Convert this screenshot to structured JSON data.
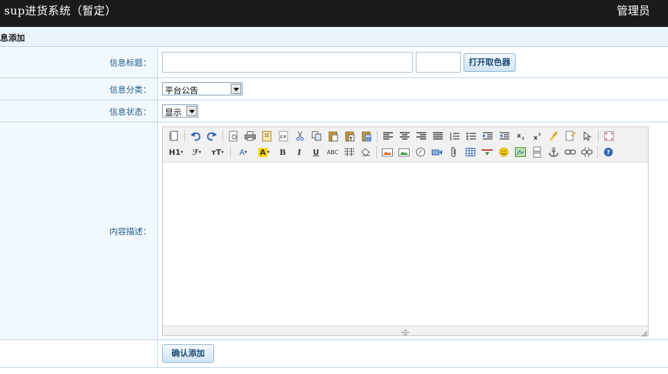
{
  "header": {
    "app_title": "sup进货系统（暂定）",
    "user": "管理员"
  },
  "section": {
    "title": "息添加"
  },
  "form": {
    "title_label": "信息标题：",
    "title_value": "",
    "color_value": "",
    "color_button": "打开取色器",
    "category_label": "信息分类：",
    "category_value": "平台公告",
    "status_label": "信息状态：",
    "status_value": "显示",
    "content_label": "内容描述：",
    "submit_button": "确认添加"
  },
  "editor": {
    "row1_icons": [
      "source-icon",
      "undo-icon",
      "redo-icon",
      "preview-icon",
      "print-icon",
      "template-icon",
      "code-icon",
      "cut-icon",
      "copy-icon",
      "paste-icon",
      "paste-text-icon",
      "paste-word-icon",
      "align-left-icon",
      "align-center-icon",
      "align-right-icon",
      "justify-icon",
      "ordered-list-icon",
      "unordered-list-icon",
      "indent-icon",
      "outdent-icon",
      "subscript-icon",
      "superscript-icon",
      "clear-format-icon",
      "quick-format-icon",
      "select-all-icon",
      "fullscreen-icon"
    ],
    "row2_icons": [
      "heading-icon",
      "font-family-icon",
      "font-size-icon",
      "font-color-icon",
      "highlight-icon",
      "bold-icon",
      "italic-icon",
      "underline-icon",
      "strikethrough-icon",
      "line-height-icon",
      "remove-format-icon",
      "image-icon",
      "multi-image-icon",
      "flash-icon",
      "media-icon",
      "attachment-icon",
      "table-icon",
      "horizontal-rule-icon",
      "emoticon-icon",
      "map-icon",
      "page-break-icon",
      "anchor-icon",
      "link-icon",
      "unlink-icon",
      "help-icon"
    ],
    "text_buttons": {
      "heading": "H1",
      "font_family": "ℱ",
      "font_size": "тT",
      "font_color": "A",
      "highlight": "A",
      "bold": "B",
      "italic": "I",
      "underline": "U",
      "strike": "ABC"
    }
  },
  "colors": {
    "topbar": "#1b1b1b",
    "label_text": "#1f5a8a",
    "border": "#b9d3ea",
    "label_bg": "#f2f9fe"
  }
}
